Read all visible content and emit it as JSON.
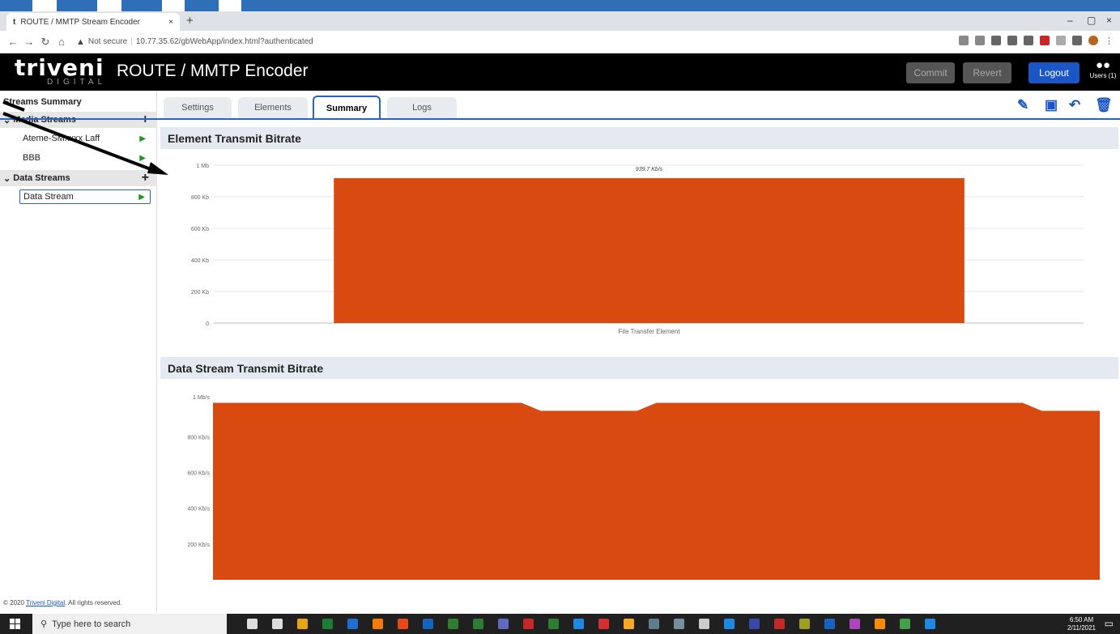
{
  "browser": {
    "tab_title": "ROUTE / MMTP Stream Encoder",
    "tab_close": "×",
    "new_tab": "+",
    "security_label": "Not secure",
    "url": "10.77.35.62/gbWebApp/index.html?authenticated",
    "window_controls": [
      "–",
      "▢",
      "×"
    ]
  },
  "header": {
    "logo_word": "triveni",
    "logo_sub": "DIGITAL",
    "title": "ROUTE / MMTP Encoder",
    "commit_label": "Commit",
    "revert_label": "Revert",
    "logout_label": "Logout",
    "users_label": "Users (1)"
  },
  "sidebar": {
    "title": "Streams Summary",
    "sections": [
      {
        "label": "Media Streams",
        "items": [
          "Ateme-SMxxxx Laff",
          "BBB"
        ]
      },
      {
        "label": "Data Streams",
        "items": [
          "Data Stream"
        ]
      }
    ],
    "footer_prefix": "© 2020 ",
    "footer_link": "Triveni Digital",
    "footer_suffix": ". All rights reserved."
  },
  "tabs": {
    "items": [
      "Settings",
      "Elements",
      "Summary",
      "Logs"
    ],
    "active": "Summary"
  },
  "toolbar_icons": [
    "edit-icon",
    "save-icon",
    "undo-icon",
    "delete-icon"
  ],
  "panels": {
    "element_title": "Element Transmit Bitrate",
    "stream_title": "Data Stream Transmit Bitrate"
  },
  "chart_data": [
    {
      "type": "bar",
      "title": "Element Transmit Bitrate",
      "categories": [
        "File Transfer Element"
      ],
      "values": [
        939.7
      ],
      "value_unit": "Kb/s",
      "data_labels": [
        "939.7 Kb/s"
      ],
      "yticks": [
        "0",
        "200 Kb",
        "400 Kb",
        "600 Kb",
        "800 Kb",
        "1 Mb"
      ],
      "ylim": [
        0,
        1024
      ],
      "grid": true,
      "color": "#d94a10"
    },
    {
      "type": "area",
      "title": "Data Stream Transmit Bitrate",
      "values": [
        990,
        990,
        990,
        990,
        990,
        990,
        990,
        990,
        990,
        990,
        990,
        990,
        990,
        990,
        990,
        990,
        990,
        945,
        945,
        945,
        945,
        945,
        945,
        990,
        990,
        990,
        990,
        990,
        990,
        990,
        990,
        990,
        990,
        990,
        990,
        990,
        990,
        990,
        990,
        990,
        990,
        990,
        990,
        945,
        945,
        945,
        945
      ],
      "value_unit": "Kb/s",
      "yticks": [
        "200 Kb/s",
        "400 Kb/s",
        "600 Kb/s",
        "800 Kb/s",
        "1 Mb/s"
      ],
      "ylim": [
        0,
        1024
      ],
      "grid": false,
      "color": "#d94a10"
    }
  ],
  "taskbar": {
    "search_placeholder": "Type here to search",
    "time": "6:50 AM",
    "date": "2/11/2021"
  }
}
